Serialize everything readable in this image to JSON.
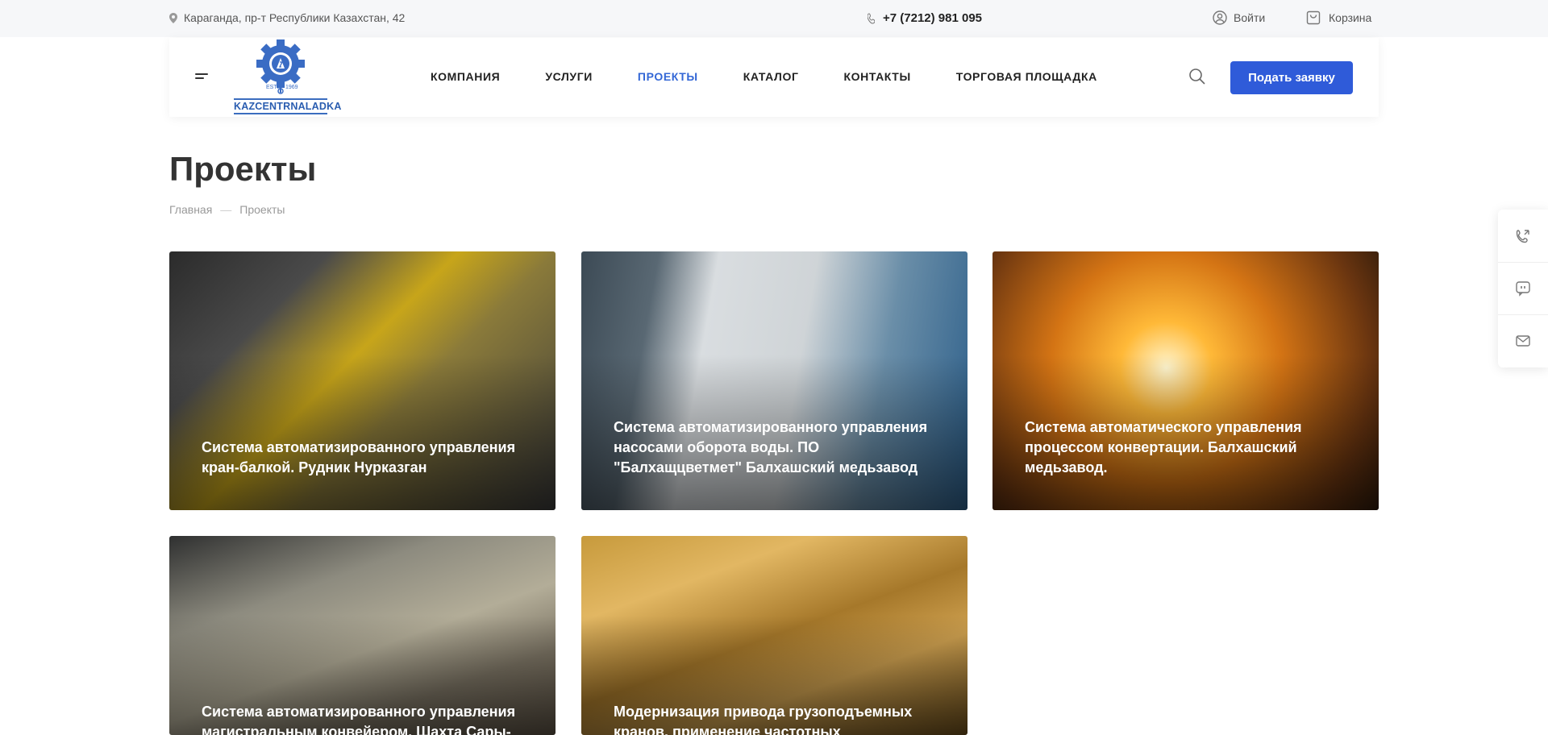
{
  "topbar": {
    "address": "Караганда, пр-т Республики Казахстан, 42",
    "phone": "+7 (7212) 981 095",
    "login_label": "Войти",
    "cart_label": "Корзина"
  },
  "header": {
    "logo": {
      "text": "KAZCENTRNALADKA",
      "estd": "ESTD",
      "year": "1969"
    },
    "nav": [
      {
        "label": "КОМПАНИЯ"
      },
      {
        "label": "УСЛУГИ"
      },
      {
        "label": "ПРОЕКТЫ"
      },
      {
        "label": "КАТАЛОГ"
      },
      {
        "label": "КОНТАКТЫ"
      },
      {
        "label": "ТОРГОВАЯ ПЛОЩАДКА"
      }
    ],
    "cta_label": "Подать заявку"
  },
  "page": {
    "title": "Проекты",
    "breadcrumb": [
      "Главная",
      "—",
      "Проекты"
    ]
  },
  "projects": [
    {
      "title": "Система автоматизированного управления кран-балкой. Рудник Нурказган"
    },
    {
      "title": "Система автоматизированного управления насосами оборота воды. ПО \"Балхащцветмет\" Балхашский медьзавод"
    },
    {
      "title": "Система автоматического управления процессом конвертации. Балхашский медьзавод."
    },
    {
      "title": "Система автоматизированного управления магистральным конвейером. Шахта Сары-"
    },
    {
      "title": "Модернизация привода грузоподъемных кранов, применение частотных"
    }
  ],
  "colors": {
    "accent": "#2f5bd9",
    "nav_active": "#3367d6",
    "logo_blue": "#2a5db0"
  },
  "icons": {
    "address": "map-pin-icon",
    "phone": "phone-icon",
    "login": "user-icon",
    "cart": "bag-icon",
    "search": "search-icon",
    "side": [
      "callback-icon",
      "chat-icon",
      "mail-icon"
    ]
  }
}
